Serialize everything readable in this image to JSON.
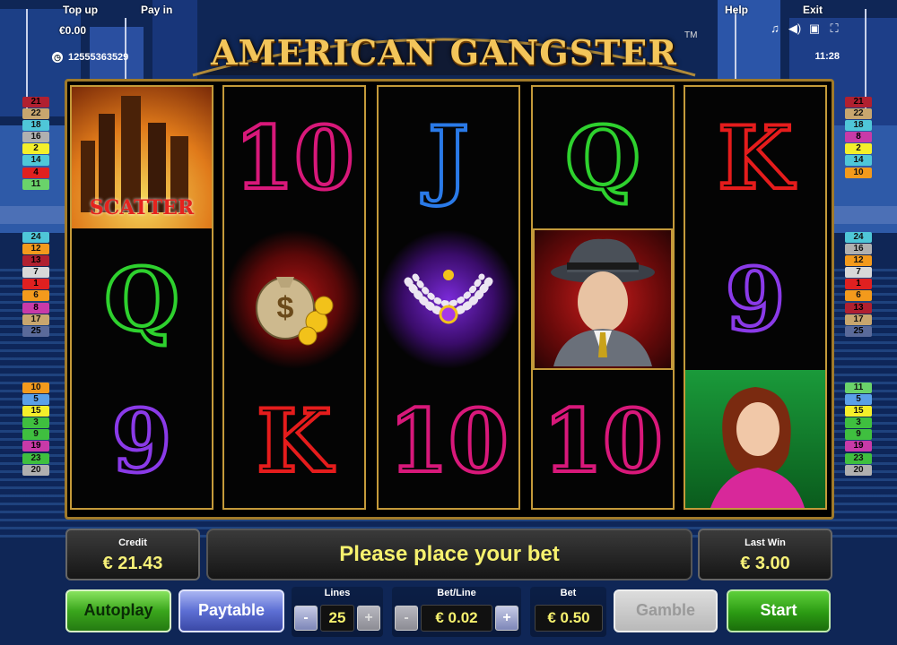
{
  "game": {
    "title": "AMERICAN GANGSTER",
    "trademark": "TM"
  },
  "topbar": {
    "top_up_label": "Top up",
    "top_up_value": "€0.00",
    "pay_in_label": "Pay in",
    "session_id": "12555363529",
    "help_label": "Help",
    "exit_label": "Exit",
    "clock": "11:28",
    "icons": [
      "music-icon",
      "speaker-icon",
      "window-icon",
      "fullscreen-icon"
    ]
  },
  "reels": [
    [
      "SCATTER",
      "Q",
      "9"
    ],
    [
      "10",
      "money-bag",
      "K"
    ],
    [
      "J",
      "necklace",
      "10"
    ],
    [
      "Q",
      "gangster",
      "10"
    ],
    [
      "K",
      "9",
      "lady"
    ]
  ],
  "scatter_label": "SCATTER",
  "left_lines_top": [
    "21",
    "22",
    "18",
    "16",
    "2",
    "14",
    "4",
    "11"
  ],
  "left_lines_mid": [
    "24",
    "12",
    "13",
    "7",
    "1",
    "6",
    "8",
    "17",
    "25"
  ],
  "left_lines_bot": [
    "10",
    "5",
    "15",
    "3",
    "9",
    "19",
    "23",
    "20"
  ],
  "right_lines_top": [
    "21",
    "22",
    "18",
    "8",
    "2",
    "14",
    "10"
  ],
  "right_lines_mid": [
    "24",
    "16",
    "12",
    "7",
    "1",
    "6",
    "13",
    "17",
    "25"
  ],
  "right_lines_bot": [
    "11",
    "5",
    "15",
    "3",
    "9",
    "19",
    "23",
    "20"
  ],
  "line_colors": {
    "1": "#e02020",
    "2": "#f4ef2a",
    "3": "#3fbf3f",
    "4": "#e02020",
    "5": "#5aa0e8",
    "6": "#f39a1c",
    "7": "#d8d8d8",
    "8": "#c83aa8",
    "9": "#3fbf3f",
    "10": "#f39a1c",
    "11": "#6ad36a",
    "12": "#f39a1c",
    "13": "#b02030",
    "14": "#4fc7d8",
    "15": "#f4ef2a",
    "16": "#b0b0b0",
    "17": "#c8a66e",
    "18": "#4fc7d8",
    "19": "#c83aa8",
    "20": "#b0b0b0",
    "21": "#b02030",
    "22": "#c8a66e",
    "23": "#3fbf3f",
    "24": "#4fc7d8",
    "25": "#5a6a9a"
  },
  "credit": {
    "label": "Credit",
    "value": "€ 21.43"
  },
  "message": "Please place your bet",
  "last_win": {
    "label": "Last Win",
    "value": "€ 3.00"
  },
  "controls": {
    "autoplay": "Autoplay",
    "paytable": "Paytable",
    "lines_label": "Lines",
    "lines_value": "25",
    "bet_line_label": "Bet/Line",
    "bet_line_value": "€ 0.02",
    "bet_label": "Bet",
    "bet_value": "€ 0.50",
    "gamble": "Gamble",
    "start": "Start",
    "minus": "-",
    "plus": "+"
  }
}
